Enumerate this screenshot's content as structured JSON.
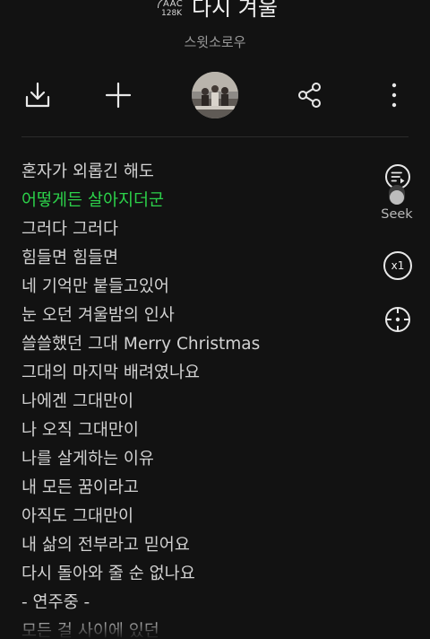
{
  "header": {
    "quality_codec": "AAC",
    "quality_bitrate": "128K",
    "song_title": "다시 겨울",
    "artist": "스윗소로우"
  },
  "toolbar": {
    "icons": [
      "download-icon",
      "add-icon",
      "album-art",
      "share-icon",
      "more-vertical-icon"
    ]
  },
  "lyrics": {
    "active_index": 1,
    "lines": [
      "혼자가 외롭긴 해도",
      "어떻게든 살아지더군",
      "그러다 그러다",
      "힘들면 힘들면",
      "네 기억만 붙들고있어",
      "눈 오던 겨울밤의 인사",
      "쓸쓸했던 그대 Merry Christmas",
      "그대의 마지막 배려였나요",
      "나에겐 그대만이",
      "나 오직 그대만이",
      "나를 살게하는 이유",
      "내 모든 꿈이라고",
      "아직도 그대만이",
      "내 삶의 전부라고 믿어요",
      "다시 돌아와 줄 순 없나요",
      "- 연주중 -",
      "모든 걸 사이에 있던"
    ]
  },
  "side_controls": {
    "seek_label": "Seek",
    "speed_label": "x1"
  },
  "colors": {
    "background": "#121212",
    "active_lyric": "#2cd14a",
    "text": "#d2d2d2"
  }
}
